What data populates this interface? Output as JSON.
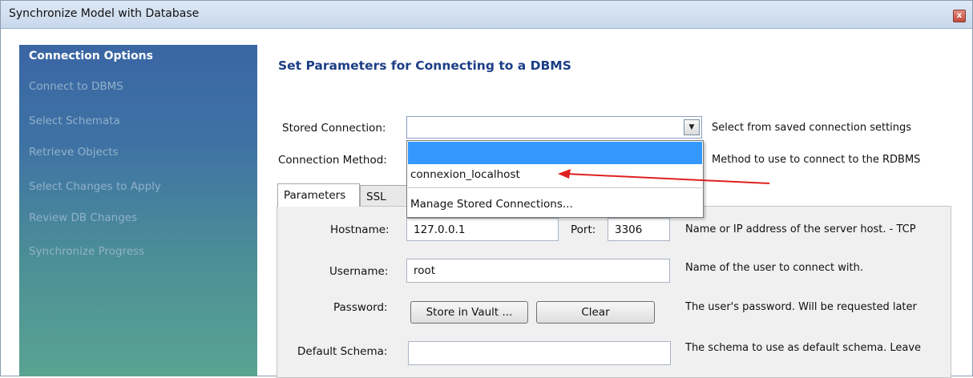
{
  "window": {
    "title": "Synchronize Model with Database",
    "close_glyph": "x"
  },
  "sidebar": {
    "items": [
      {
        "label": "Connection Options",
        "active": true
      },
      {
        "label": "Connect to DBMS",
        "active": false
      },
      {
        "label": "Select Schemata",
        "active": false
      },
      {
        "label": "Retrieve Objects",
        "active": false
      },
      {
        "label": "Select Changes to Apply",
        "active": false
      },
      {
        "label": "Review DB Changes",
        "active": false
      },
      {
        "label": "Synchronize Progress",
        "active": false
      }
    ]
  },
  "main": {
    "title": "Set Parameters for Connecting to a DBMS",
    "stored_connection": {
      "label": "Stored Connection:",
      "value": "",
      "description": "Select from saved connection settings",
      "arrow_glyph": "▼"
    },
    "connection_method": {
      "label": "Connection Method:",
      "description": "Method to use to connect to the RDBMS"
    },
    "dropdown": {
      "items": [
        "",
        "connexion_localhost",
        "Manage Stored Connections..."
      ],
      "highlighted_index": 0,
      "annotation_color": "#e02020"
    },
    "tabs": [
      {
        "label": "Parameters",
        "active": true
      },
      {
        "label": "SSL",
        "active": false
      }
    ],
    "params": {
      "hostname": {
        "label": "Hostname:",
        "value": "127.0.0.1",
        "port_label": "Port:",
        "port_value": "3306",
        "description": "Name or IP address of the server host. - TCP"
      },
      "username": {
        "label": "Username:",
        "value": "root",
        "description": "Name of the user to connect with."
      },
      "password": {
        "label": "Password:",
        "store_button": "Store in Vault ...",
        "clear_button": "Clear",
        "description": "The user's password. Will be requested later"
      },
      "default_schema": {
        "label": "Default Schema:",
        "value": "",
        "description": "The schema to use as default schema. Leave"
      }
    }
  },
  "colors": {
    "accent": "#1c3e86",
    "selection": "#3399ff",
    "annotation_arrow": "#e02020"
  }
}
